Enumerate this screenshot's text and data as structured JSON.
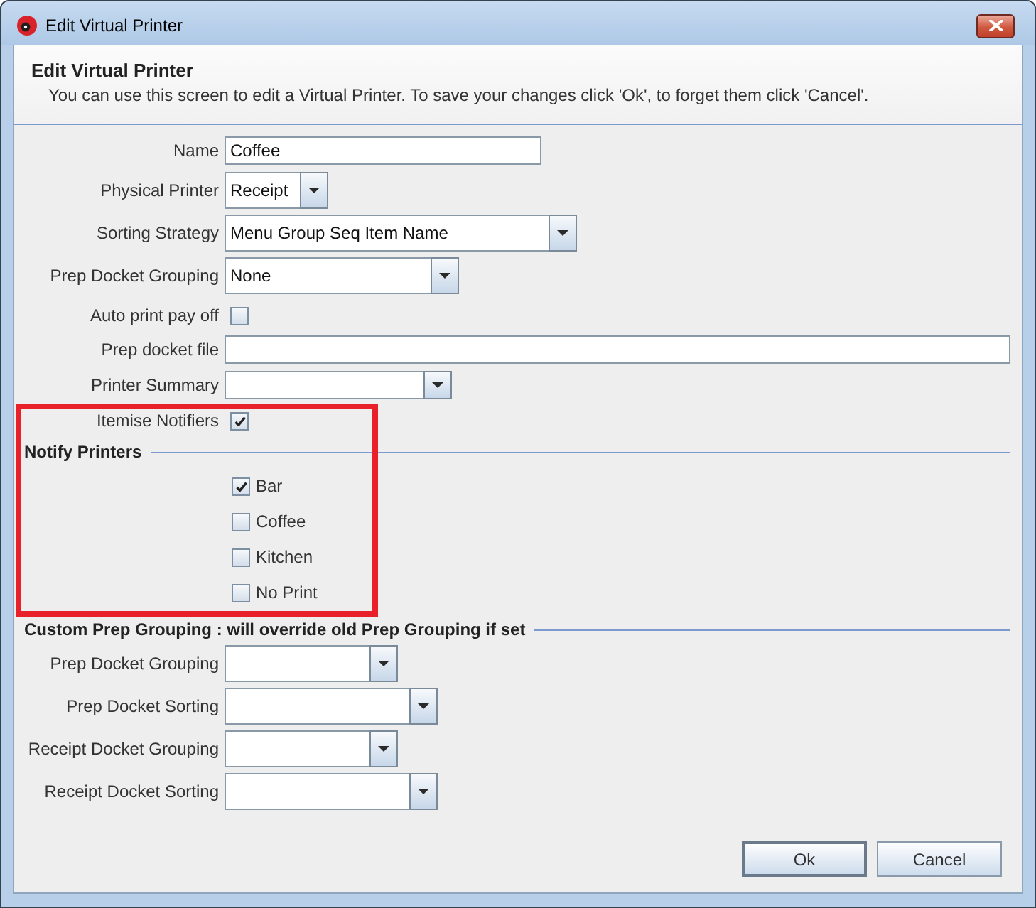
{
  "window": {
    "title": "Edit Virtual Printer"
  },
  "header": {
    "title": "Edit Virtual Printer",
    "description": "You can use this screen to edit a Virtual Printer. To save your changes click 'Ok', to forget them click 'Cancel'."
  },
  "fields": [
    {
      "kind": "text",
      "label": "Name",
      "value": "Coffee"
    },
    {
      "kind": "combo",
      "label": "Physical Printer",
      "value": "Receipt"
    },
    {
      "kind": "combo",
      "label": "Sorting Strategy",
      "value": "Menu Group Seq Item Name"
    },
    {
      "kind": "combo",
      "label": "Prep Docket Grouping",
      "value": "None"
    },
    {
      "kind": "checkbox",
      "label": "Auto print pay off",
      "checked": false
    },
    {
      "kind": "text",
      "label": "Prep docket file"
    },
    {
      "kind": "combo",
      "label": "Printer Summary"
    },
    {
      "kind": "checkbox",
      "label": "Itemise Notifiers",
      "checked": true
    }
  ],
  "notify_printers": {
    "title": "Notify Printers",
    "highlighted": true,
    "printers": [
      {
        "label": "Bar",
        "checked": true
      },
      {
        "label": "Coffee",
        "checked": false
      },
      {
        "label": "Kitchen",
        "checked": false
      },
      {
        "label": "No Print",
        "checked": false
      }
    ]
  },
  "custom_prep_grouping": {
    "title": "Custom Prep Grouping : will override old Prep Grouping if set",
    "fields": [
      {
        "kind": "combo",
        "label": "Prep Docket Grouping"
      },
      {
        "kind": "combo",
        "label": "Prep Docket Sorting"
      },
      {
        "kind": "combo",
        "label": "Receipt Docket Grouping"
      },
      {
        "kind": "combo",
        "label": "Receipt Docket Sorting"
      }
    ]
  },
  "buttons": [
    {
      "label": "Ok",
      "default": true
    },
    {
      "label": "Cancel",
      "default": false
    }
  ]
}
